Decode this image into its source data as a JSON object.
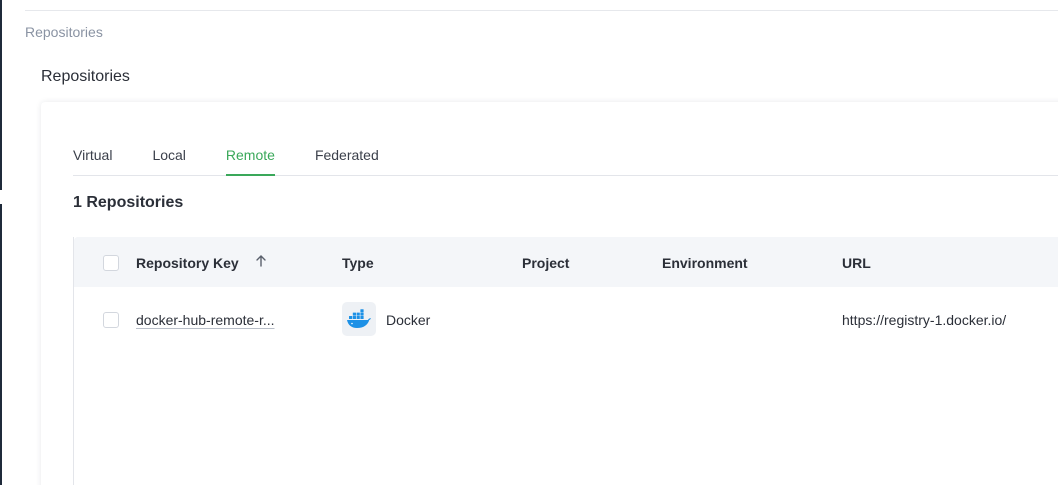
{
  "breadcrumb": "Repositories",
  "page_title": "Repositories",
  "tabs": [
    {
      "label": "Virtual",
      "active": false
    },
    {
      "label": "Local",
      "active": false
    },
    {
      "label": "Remote",
      "active": true
    },
    {
      "label": "Federated",
      "active": false
    }
  ],
  "repo_count_label": "1 Repositories",
  "table": {
    "columns": [
      "Repository Key",
      "Type",
      "Project",
      "Environment",
      "URL"
    ],
    "sort": {
      "column": "Repository Key",
      "direction": "ascending",
      "icon": "arrow-up-icon"
    },
    "rows": [
      {
        "key": "docker-hub-remote-r...",
        "type": "Docker",
        "type_icon": "docker-icon",
        "project": "",
        "environment": "",
        "url": "https://registry-1.docker.io/"
      }
    ]
  },
  "colors": {
    "accent": "#3aa85a",
    "docker_blue": "#1d91e6",
    "header_bg": "#f4f6f9",
    "muted_text": "#8a93a3"
  }
}
